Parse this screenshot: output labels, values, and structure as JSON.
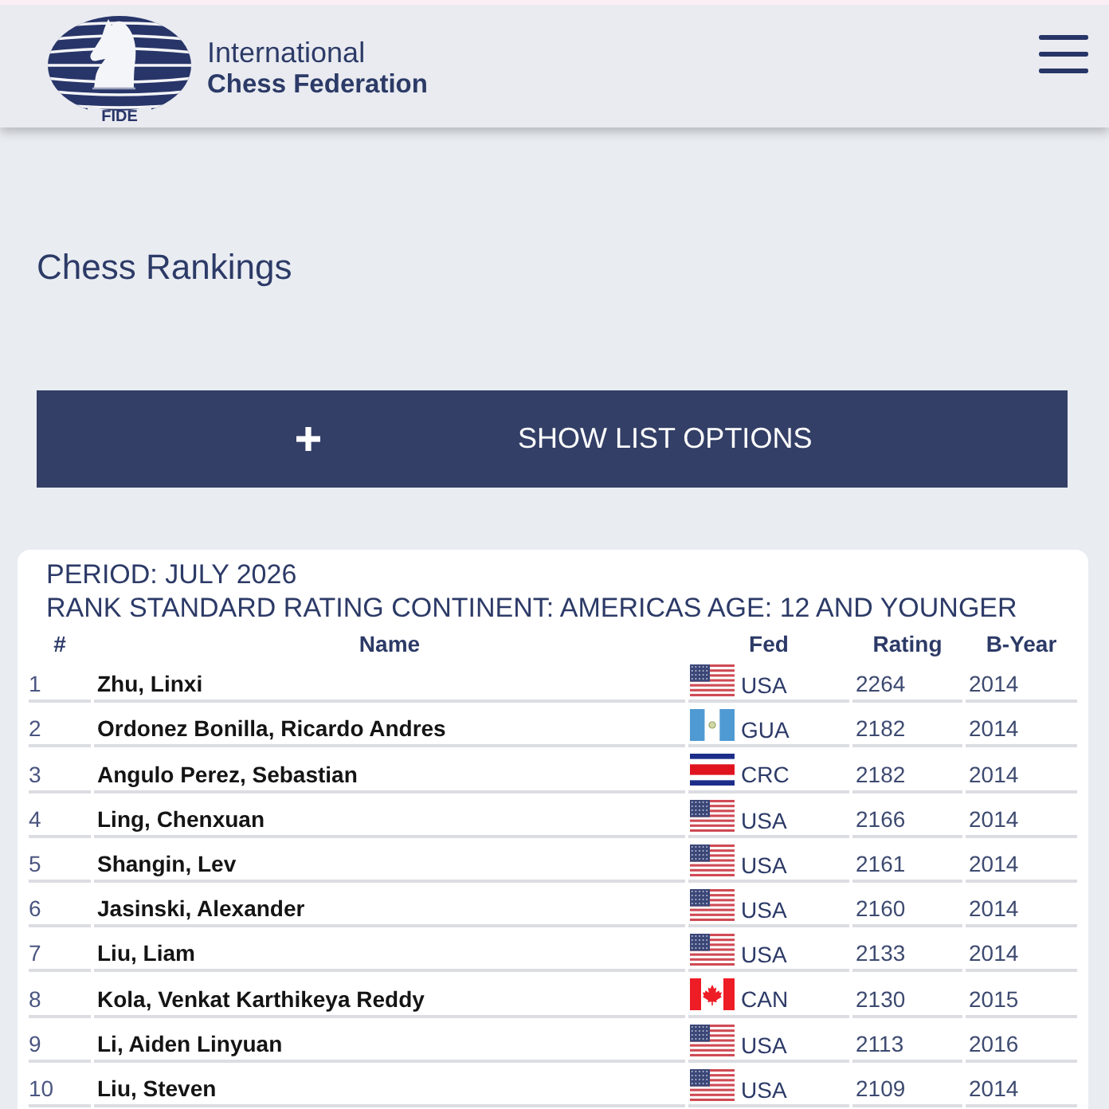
{
  "header": {
    "logo_label": "FIDE",
    "brand_line_1": "International",
    "brand_line_2": "Chess Federation"
  },
  "page_title": "Chess Rankings",
  "options_button": {
    "label": "SHOW LIST OPTIONS"
  },
  "ranking_list": {
    "period": "PERIOD: JULY 2026",
    "description": "RANK STANDARD RATING CONTINENT: AMERICAS AGE: 12 AND YOUNGER",
    "table": {
      "columns": [
        "#",
        "Name",
        "Fed",
        "Rating",
        "B-Year"
      ],
      "rows": [
        {
          "rank": "1",
          "name": "Zhu, Linxi",
          "flag": {
            "kind": "usa"
          },
          "fed": "USA",
          "rating": "2264",
          "birth_year": "2014"
        },
        {
          "rank": "2",
          "name": "Ordonez Bonilla, Ricardo Andres",
          "flag": {
            "kind": "guatemala"
          },
          "fed": "GUA",
          "rating": "2182",
          "birth_year": "2014"
        },
        {
          "rank": "3",
          "name": "Angulo Perez, Sebastian",
          "flag": {
            "kind": "costarica"
          },
          "fed": "CRC",
          "rating": "2182",
          "birth_year": "2014"
        },
        {
          "rank": "4",
          "name": "Ling, Chenxuan",
          "flag": {
            "kind": "usa"
          },
          "fed": "USA",
          "rating": "2166",
          "birth_year": "2014"
        },
        {
          "rank": "5",
          "name": "Shangin, Lev",
          "flag": {
            "kind": "usa"
          },
          "fed": "USA",
          "rating": "2161",
          "birth_year": "2014"
        },
        {
          "rank": "6",
          "name": "Jasinski, Alexander",
          "flag": {
            "kind": "usa"
          },
          "fed": "USA",
          "rating": "2160",
          "birth_year": "2014"
        },
        {
          "rank": "7",
          "name": "Liu, Liam",
          "flag": {
            "kind": "usa"
          },
          "fed": "USA",
          "rating": "2133",
          "birth_year": "2014"
        },
        {
          "rank": "8",
          "name": "Kola, Venkat Karthikeya Reddy",
          "flag": {
            "kind": "canada"
          },
          "fed": "CAN",
          "rating": "2130",
          "birth_year": "2015"
        },
        {
          "rank": "9",
          "name": "Li, Aiden Linyuan",
          "flag": {
            "kind": "usa"
          },
          "fed": "USA",
          "rating": "2113",
          "birth_year": "2016"
        },
        {
          "rank": "10",
          "name": "Liu, Steven",
          "flag": {
            "kind": "usa"
          },
          "fed": "USA",
          "rating": "2109",
          "birth_year": "2014"
        }
      ]
    }
  }
}
